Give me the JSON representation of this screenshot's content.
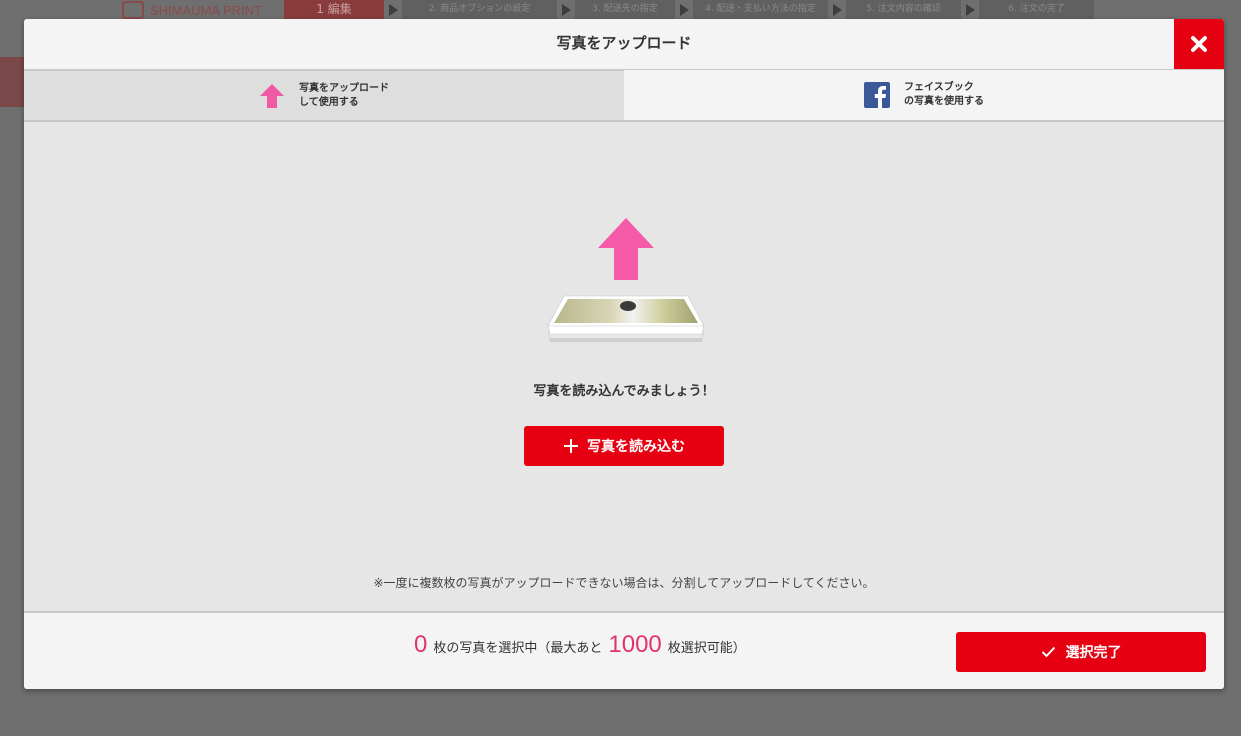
{
  "background": {
    "logo_text": "SHIMAUMA PRINT",
    "steps": [
      "1 編集",
      "2. 商品オプションの設定",
      "3. 配送先の指定",
      "4. 配送・支払い方法の指定",
      "5. 注文内容の確認",
      "6. 注文の完了"
    ]
  },
  "modal": {
    "title": "写真をアップロード",
    "close_icon": "close-x-icon",
    "tabs": [
      {
        "line1": "写真をアップロード",
        "line2": "して使用する",
        "icon": "upload-arrow-icon",
        "active": true
      },
      {
        "line1": "フェイスブック",
        "line2": "の写真を使用する",
        "icon": "facebook-icon",
        "active": false
      }
    ],
    "prompt": "写真を読み込んでみましょう！",
    "load_button": {
      "icon": "plus-icon",
      "label": "写真を読み込む"
    },
    "note": "※一度に複数枚の写真がアップロードできない場合は、分割してアップロードしてください。"
  },
  "footer": {
    "selected_count": "0",
    "text1": "枚の写真を選択中（最大あと",
    "max_count": "1000",
    "text2": "枚選択可能）",
    "done_button": {
      "icon": "check-icon",
      "label": "選択完了"
    }
  },
  "colors": {
    "accent_red": "#e60012",
    "pink": "#f05aa5",
    "count_pink": "#e2336c",
    "facebook_blue": "#3b5998"
  }
}
